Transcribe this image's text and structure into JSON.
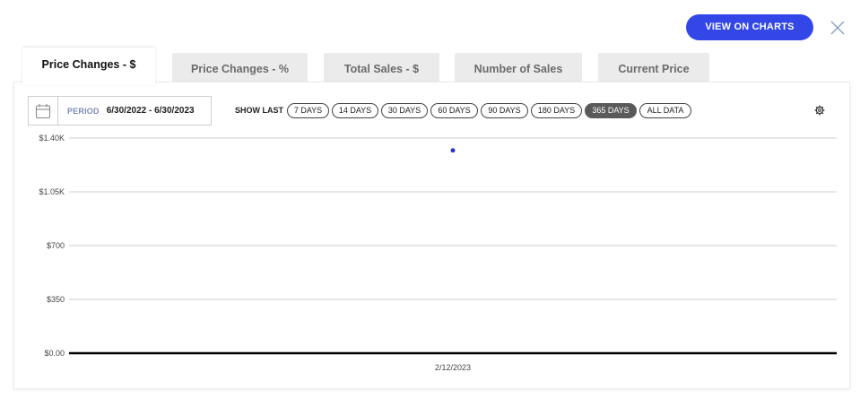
{
  "header": {
    "view_on_charts_label": "VIEW ON CHARTS"
  },
  "tabs": [
    {
      "label": "Price Changes - $",
      "active": true
    },
    {
      "label": "Price Changes - %",
      "active": false
    },
    {
      "label": "Total Sales - $",
      "active": false
    },
    {
      "label": "Number of Sales",
      "active": false
    },
    {
      "label": "Current Price",
      "active": false
    }
  ],
  "toolbar": {
    "period_label": "PERIOD",
    "period_value": "6/30/2022 - 6/30/2023",
    "show_last_label": "SHOW LAST",
    "ranges": [
      "7 DAYS",
      "14 DAYS",
      "30 DAYS",
      "60 DAYS",
      "90 DAYS",
      "180 DAYS",
      "365 DAYS",
      "ALL DATA"
    ],
    "selected_range": "365 DAYS"
  },
  "icons": {
    "calendar": "calendar-icon",
    "close": "close-icon",
    "settings": "gear-icon"
  },
  "colors": {
    "accent": "#3347e8",
    "point": "#2a35c9",
    "selected_pill": "#5a5a5a"
  },
  "chart_data": {
    "type": "scatter",
    "title": "",
    "xlabel": "",
    "ylabel": "",
    "ylim": [
      0,
      1400
    ],
    "y_ticks": [
      0,
      350,
      700,
      1050,
      1400
    ],
    "y_tick_labels": [
      "$0.00",
      "$350",
      "$700",
      "$1.05K",
      "$1.40K"
    ],
    "x_tick_labels": [
      "2/12/2023"
    ],
    "grid": true,
    "points": [
      {
        "x": "2/12/2023",
        "y": 1320
      }
    ]
  }
}
